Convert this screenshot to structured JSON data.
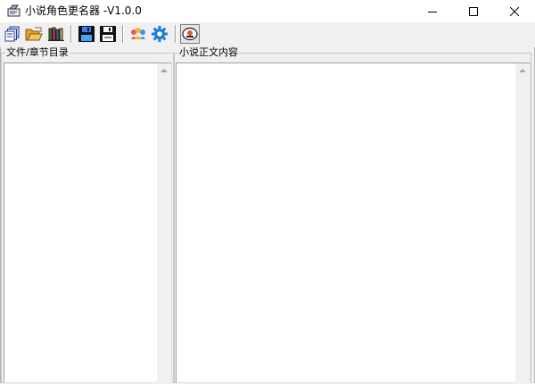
{
  "window": {
    "title": "小说角色更名器  -V1.0.0",
    "controls": {
      "minimize": "minimize",
      "maximize": "maximize",
      "close": "close"
    }
  },
  "toolbar": {
    "buttons": [
      {
        "name": "new-documents-button",
        "icon": "documents-icon"
      },
      {
        "name": "open-folder-button",
        "icon": "folder-open-icon"
      },
      {
        "name": "library-button",
        "icon": "books-icon"
      },
      {
        "name": "save-button",
        "icon": "floppy-blue-icon"
      },
      {
        "name": "save-as-button",
        "icon": "floppy-black-icon"
      },
      {
        "name": "characters-button",
        "icon": "people-icon"
      },
      {
        "name": "settings-button",
        "icon": "gear-icon"
      },
      {
        "name": "about-button",
        "icon": "badge-icon"
      }
    ]
  },
  "panels": {
    "chapters": {
      "label": "文件/章节目录"
    },
    "content": {
      "label": "小说正文内容"
    }
  },
  "colors": {
    "titlebar": "#ffffff",
    "window": "#f0f0f0",
    "pane": "#ffffff",
    "scrollbar": "#f0f0f0"
  }
}
